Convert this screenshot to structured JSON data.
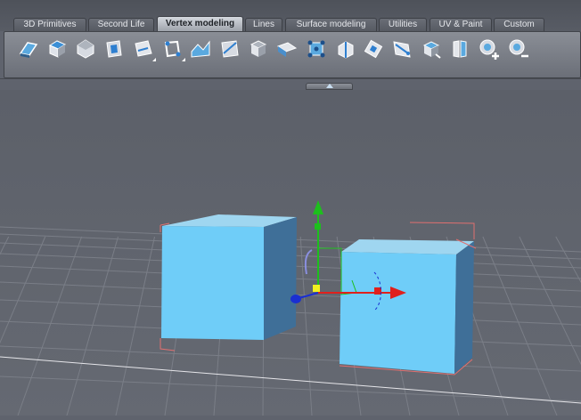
{
  "tabs": [
    {
      "label": "3D Primitives",
      "active": false
    },
    {
      "label": "Second Life",
      "active": false
    },
    {
      "label": "Vertex modeling",
      "active": true
    },
    {
      "label": "Lines",
      "active": false
    },
    {
      "label": "Surface modeling",
      "active": false
    },
    {
      "label": "Utilities",
      "active": false
    },
    {
      "label": "UV & Paint",
      "active": false
    },
    {
      "label": "Custom",
      "active": false
    }
  ],
  "toolbar": {
    "tools": [
      {
        "icon": "extrude-face-icon",
        "flyout": false
      },
      {
        "icon": "select-face-icon",
        "flyout": false
      },
      {
        "icon": "bevel-vertex-icon",
        "flyout": false
      },
      {
        "icon": "inset-face-icon",
        "flyout": false
      },
      {
        "icon": "extrude-edge-icon",
        "flyout": true
      },
      {
        "icon": "bevel-edges-icon",
        "flyout": true
      },
      {
        "icon": "bridge-icon",
        "flyout": false
      },
      {
        "icon": "cut-face-icon",
        "flyout": false
      },
      {
        "icon": "tessellate-icon",
        "flyout": false
      },
      {
        "icon": "weld-vertices-icon",
        "flyout": false
      },
      {
        "icon": "connect-vertices-icon",
        "flyout": false
      },
      {
        "icon": "chamfer-icon",
        "flyout": false
      },
      {
        "icon": "knife-icon",
        "flyout": false
      },
      {
        "icon": "extrude-path-icon",
        "flyout": false
      },
      {
        "icon": "slice-mesh-icon",
        "flyout": false
      },
      {
        "icon": "split-mesh-icon",
        "flyout": false
      },
      {
        "icon": "add-vertex-icon",
        "flyout": false
      },
      {
        "icon": "remove-vertex-icon",
        "flyout": false
      }
    ]
  },
  "colors": {
    "cube_front": "#6fcdf8",
    "cube_top": "#9fd6f0",
    "cube_side": "#3f6f98",
    "grid": "#7a7e87",
    "axis_x": "#e0201c",
    "axis_y": "#1dbf1d",
    "axis_z": "#1a2fd2",
    "selection_box": "#e07070"
  }
}
